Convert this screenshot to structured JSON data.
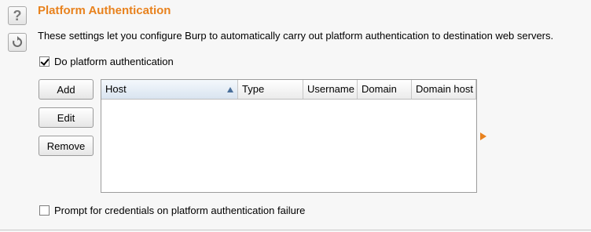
{
  "panel": {
    "title": "Platform Authentication",
    "description": "These settings let you configure Burp to automatically carry out platform authentication to destination web servers.",
    "help_label": "?",
    "accent_color": "#e8821e"
  },
  "options": {
    "do_platform_auth": {
      "label": "Do platform authentication",
      "checked": true
    },
    "prompt_credentials": {
      "label": "Prompt for credentials on platform authentication failure",
      "checked": false
    }
  },
  "buttons": {
    "add": "Add",
    "edit": "Edit",
    "remove": "Remove"
  },
  "table": {
    "columns": [
      "Host",
      "Type",
      "Username",
      "Domain",
      "Domain host"
    ],
    "sorted_column": "Host",
    "sort_direction": "ascending",
    "rows": []
  }
}
